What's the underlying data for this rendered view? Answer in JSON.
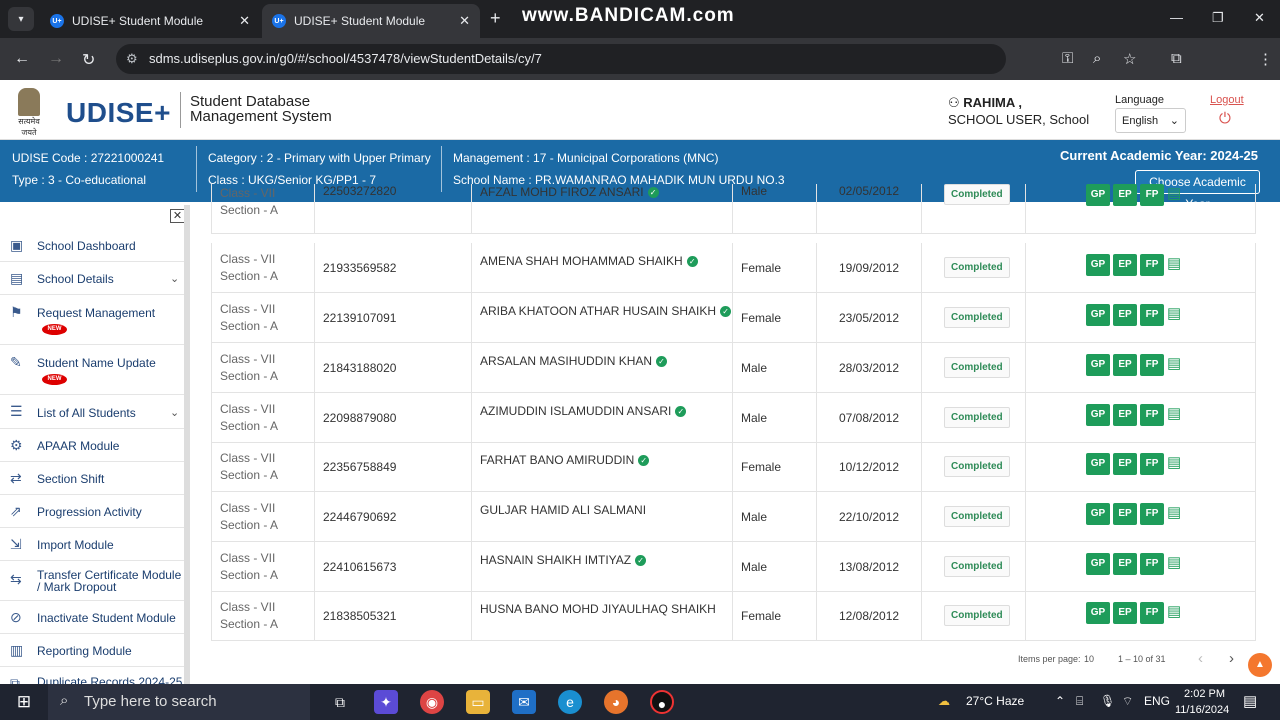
{
  "browser": {
    "tabs": [
      {
        "label": "UDISE+ Student Module"
      },
      {
        "label": "UDISE+ Student Module"
      }
    ],
    "watermark": "www.BANDICAM.com",
    "url": "sdms.udiseplus.gov.in/g0/#/school/4537478/viewStudentDetails/cy/7"
  },
  "header": {
    "logo": "UDISE+",
    "emblem_text": "सत्यमेव जयते",
    "title_line1": "Student Database",
    "title_line2": "Management System",
    "user_name": "RAHIMA ,",
    "user_role": "SCHOOL USER,   School",
    "language_label": "Language",
    "language_value": "English",
    "logout": "Logout"
  },
  "info": {
    "udise": "UDISE Code : 27221000241",
    "type": "Type : 3 - Co-educational",
    "category": "Category : 2 - Primary with Upper Primary",
    "class": "Class : UKG/Senior KG/PP1 - 7",
    "management": "Management : 17 - Municipal Corporations (MNC)",
    "school": "School Name : PR.WAMANRAO MAHADIK MUN URDU NO.3",
    "academic_year": "Current Academic Year: 2024-25",
    "choose_btn": "Choose Academic Year"
  },
  "sidebar": {
    "items": [
      {
        "label": "School Dashboard",
        "icon": "dashboard-icon"
      },
      {
        "label": "School Details",
        "icon": "details-icon"
      },
      {
        "label": "Request Management",
        "icon": "request-icon",
        "badge": "NEW"
      },
      {
        "label": "Student Name Update",
        "icon": "user-edit-icon",
        "badge": "NEW"
      },
      {
        "label": "List of All Students",
        "icon": "list-icon"
      },
      {
        "label": "APAAR Module",
        "icon": "apaar-icon"
      },
      {
        "label": "Section Shift",
        "icon": "shift-icon"
      },
      {
        "label": "Progression Activity",
        "icon": "progression-icon"
      },
      {
        "label": "Import Module",
        "icon": "import-icon"
      },
      {
        "label": "Transfer Certificate Module / Mark Dropout",
        "icon": "transfer-icon"
      },
      {
        "label": "Inactivate Student Module",
        "icon": "inactivate-icon"
      },
      {
        "label": "Reporting Module",
        "icon": "report-icon"
      },
      {
        "label": "Duplicate Records 2024-25",
        "icon": "duplicate-icon"
      }
    ]
  },
  "table": {
    "rows": [
      {
        "class": "Class - VII",
        "section": "Section - A",
        "pen": "22503272820",
        "name": "AFZAL MOHD FIROZ ANSARI",
        "verified": true,
        "gender": "Male",
        "dob": "02/05/2012",
        "status": "Completed"
      },
      {
        "class": "Class - VII",
        "section": "Section - A",
        "pen": "21933569582",
        "name": "AMENA SHAH MOHAMMAD SHAIKH",
        "verified": true,
        "gender": "Female",
        "dob": "19/09/2012",
        "status": "Completed"
      },
      {
        "class": "Class - VII",
        "section": "Section - A",
        "pen": "22139107091",
        "name": "ARIBA KHATOON ATHAR HUSAIN SHAIKH",
        "verified": true,
        "gender": "Female",
        "dob": "23/05/2012",
        "status": "Completed"
      },
      {
        "class": "Class - VII",
        "section": "Section - A",
        "pen": "21843188020",
        "name": "ARSALAN MASIHUDDIN KHAN",
        "verified": true,
        "gender": "Male",
        "dob": "28/03/2012",
        "status": "Completed"
      },
      {
        "class": "Class - VII",
        "section": "Section - A",
        "pen": "22098879080",
        "name": "AZIMUDDIN ISLAMUDDIN ANSARI",
        "verified": true,
        "gender": "Male",
        "dob": "07/08/2012",
        "status": "Completed"
      },
      {
        "class": "Class - VII",
        "section": "Section - A",
        "pen": "22356758849",
        "name": "FARHAT BANO AMIRUDDIN",
        "verified": true,
        "gender": "Female",
        "dob": "10/12/2012",
        "status": "Completed"
      },
      {
        "class": "Class - VII",
        "section": "Section - A",
        "pen": "22446790692",
        "name": "GULJAR HAMID ALI SALMANI",
        "verified": false,
        "gender": "Male",
        "dob": "22/10/2012",
        "status": "Completed"
      },
      {
        "class": "Class - VII",
        "section": "Section - A",
        "pen": "22410615673",
        "name": "HASNAIN SHAIKH IMTIYAZ",
        "verified": true,
        "gender": "Male",
        "dob": "13/08/2012",
        "status": "Completed"
      },
      {
        "class": "Class - VII",
        "section": "Section - A",
        "pen": "21838505321",
        "name": "HUSNA BANO MOHD JIYAULHAQ SHAIKH",
        "verified": false,
        "gender": "Female",
        "dob": "12/08/2012",
        "status": "Completed"
      }
    ],
    "action_buttons": [
      "GP",
      "EP",
      "FP"
    ]
  },
  "pagination": {
    "items_per_page_label": "Items per page:",
    "items_per_page": "10",
    "range": "1 – 10 of 31"
  },
  "taskbar": {
    "search_placeholder": "Type here to search",
    "weather": "27°C  Haze",
    "lang": "ENG",
    "time": "2:02 PM",
    "date": "11/16/2024"
  },
  "colors": {
    "brand_blue": "#1b6aa5",
    "action_green": "#1e9c5a",
    "logout_red": "#d9534f"
  }
}
